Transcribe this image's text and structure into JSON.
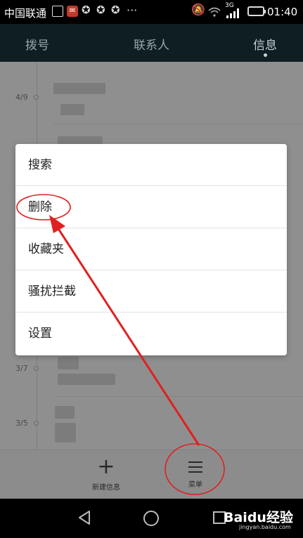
{
  "status_bar": {
    "carrier": "中国联通",
    "time": "01:40",
    "network": "3G",
    "icons": [
      "picture-icon",
      "app-icon",
      "star-icon",
      "star-icon",
      "star-icon",
      "more-icon",
      "mute-icon",
      "wifi-icon",
      "signal-icon",
      "battery-icon"
    ]
  },
  "tabs": [
    {
      "label": "拨号"
    },
    {
      "label": "联系人"
    },
    {
      "label": "信息"
    }
  ],
  "list": {
    "dates": [
      "4/9",
      "3/7",
      "3/5"
    ]
  },
  "popup_menu": {
    "items": [
      {
        "label": "搜索"
      },
      {
        "label": "删除"
      },
      {
        "label": "收藏夹"
      },
      {
        "label": "骚扰拦截"
      },
      {
        "label": "设置"
      }
    ]
  },
  "bottom_bar": {
    "new_message_label": "新建信息",
    "menu_label": "菜单"
  },
  "watermark": {
    "brand": "Baidu经验",
    "url": "jingyan.baidu.com"
  },
  "colors": {
    "header_bg": "#0e1e22",
    "dim_overlay": "#8f8f8f",
    "annotation_red": "#e02020"
  }
}
